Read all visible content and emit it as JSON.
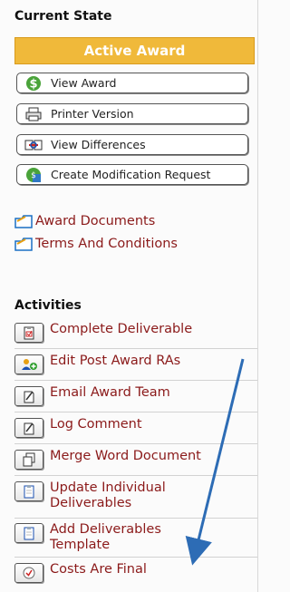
{
  "current_state": {
    "heading": "Current State",
    "status": "Active Award",
    "buttons": [
      {
        "label": "View Award",
        "icon": "dollar-icon"
      },
      {
        "label": "Printer Version",
        "icon": "printer-icon"
      },
      {
        "label": "View Differences",
        "icon": "compare-icon"
      },
      {
        "label": "Create Modification Request",
        "icon": "modification-icon"
      }
    ]
  },
  "links": [
    {
      "label": "Award Documents",
      "icon": "folder-icon"
    },
    {
      "label": "Terms And Conditions",
      "icon": "folder-icon"
    }
  ],
  "activities": {
    "heading": "Activities",
    "items": [
      {
        "label": "Complete Deliverable",
        "icon": "clipboard-check-icon"
      },
      {
        "label": "Edit Post Award RAs",
        "icon": "add-person-icon"
      },
      {
        "label": "Email Award Team",
        "icon": "note-icon"
      },
      {
        "label": "Log Comment",
        "icon": "note-icon"
      },
      {
        "label": "Merge Word Document",
        "icon": "copy-icon"
      },
      {
        "label": "Update Individual Deliverables",
        "icon": "clipboard-icon"
      },
      {
        "label": "Add Deliverables Template",
        "icon": "clipboard-icon"
      },
      {
        "label": "Costs Are Final",
        "icon": "check-circle-icon"
      }
    ]
  },
  "colors": {
    "status_bg": "#f0b93a",
    "link": "#8b1a1a",
    "arrow": "#2d6cb5"
  }
}
